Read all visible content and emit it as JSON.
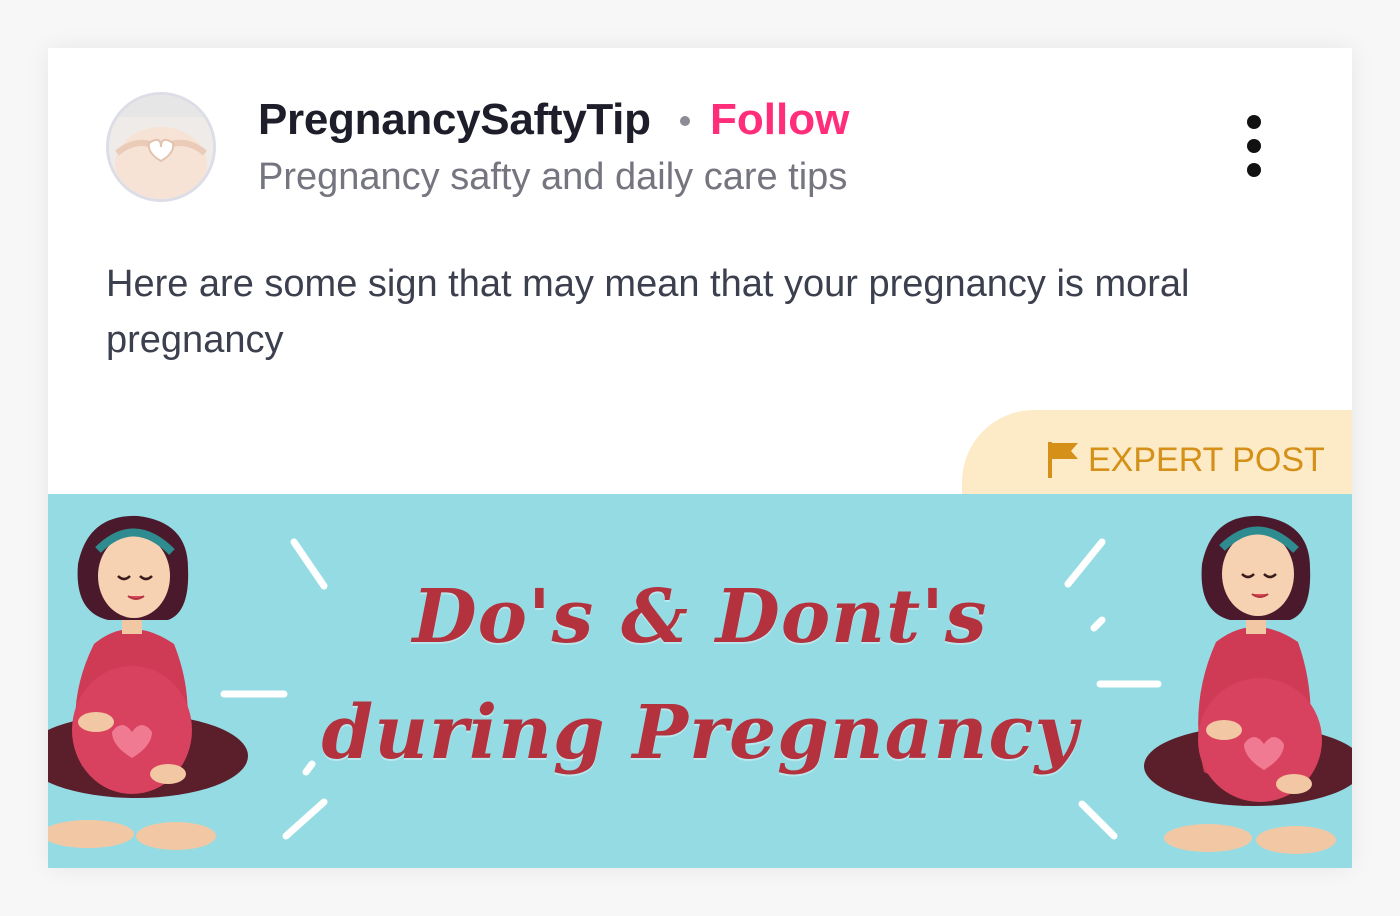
{
  "post": {
    "author": {
      "name": "PregnancySaftyTip",
      "follow_label": "Follow",
      "description": "Pregnancy safty and daily care tips",
      "avatar_icon": "pregnant-belly-heart-hands-icon"
    },
    "menu_icon": "more-vertical-icon",
    "text": "Here are some sign that may mean that your pregnancy is moral pregnancy",
    "badge": {
      "label": "EXPERT POST",
      "icon": "flag-icon"
    },
    "banner": {
      "line1": "Do's & Dont's",
      "line2": "during Pregnancy"
    }
  },
  "colors": {
    "follow": "#ff2d7a",
    "badge_bg": "#fcebc6",
    "badge_text": "#d5901a",
    "banner_bg": "#94dbe3",
    "banner_text": "#b3323e"
  }
}
